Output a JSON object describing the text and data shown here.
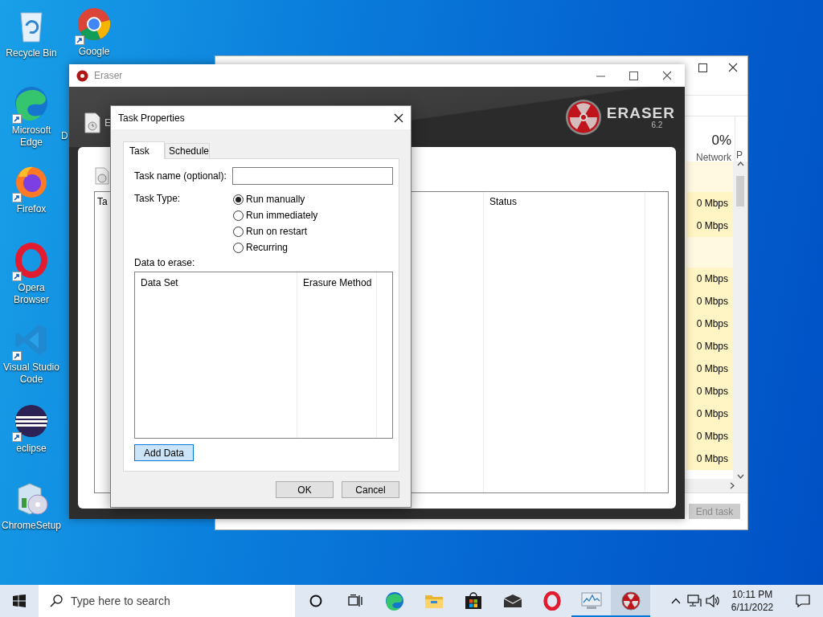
{
  "desktop": {
    "icons": [
      {
        "label": "Recycle Bin",
        "kind": "bin",
        "shortcut": false
      },
      {
        "label": "Google",
        "kind": "chrome",
        "shortcut": true
      },
      {
        "label": "Microsoft Edge",
        "kind": "edge",
        "shortcut": true
      },
      {
        "label": "D",
        "kind": "hidden",
        "shortcut": false
      },
      {
        "label": "Firefox",
        "kind": "firefox",
        "shortcut": true
      },
      {
        "label": "Opera Browser",
        "kind": "opera",
        "shortcut": true
      },
      {
        "label": "Visual Studio Code",
        "kind": "vscode",
        "shortcut": true
      },
      {
        "label": "eclipse",
        "kind": "eclipse",
        "shortcut": true
      },
      {
        "label": "ChromeSetup",
        "kind": "setup",
        "shortcut": false
      }
    ]
  },
  "task_manager": {
    "usage": "0%",
    "column_header": "Network",
    "column_2_header": "P",
    "rows": [
      {
        "kind": "group"
      },
      {
        "kind": "value",
        "network": "0 Mbps"
      },
      {
        "kind": "value",
        "network": "0 Mbps"
      },
      {
        "kind": "group"
      },
      {
        "kind": "value",
        "network": "0 Mbps"
      },
      {
        "kind": "value",
        "network": "0 Mbps"
      },
      {
        "kind": "value",
        "network": "0 Mbps"
      },
      {
        "kind": "value",
        "network": "0 Mbps"
      },
      {
        "kind": "value",
        "network": "0 Mbps"
      },
      {
        "kind": "value",
        "network": "0 Mbps"
      },
      {
        "kind": "value",
        "network": "0 Mbps"
      },
      {
        "kind": "value",
        "network": "0 Mbps"
      },
      {
        "kind": "value",
        "network": "0 Mbps"
      }
    ],
    "end_task": {
      "label": "End task",
      "disabled": true
    }
  },
  "eraser": {
    "title": "Eraser",
    "toolbar_label": "E",
    "logo": {
      "name": "ERASER",
      "version": "6.2"
    },
    "columns": [
      "Ta",
      "Status"
    ]
  },
  "dialog": {
    "title": "Task Properties",
    "tabs": [
      {
        "label": "Task",
        "selected": true
      },
      {
        "label": "Schedule",
        "selected": false
      }
    ],
    "task_name": {
      "label": "Task name (optional):"
    },
    "task_type": {
      "label": "Task Type:",
      "options": [
        {
          "label": "Run manually",
          "selected": true
        },
        {
          "label": "Run immediately",
          "selected": false
        },
        {
          "label": "Run on restart",
          "selected": false
        },
        {
          "label": "Recurring",
          "selected": false
        }
      ]
    },
    "data": {
      "label": "Data to erase:",
      "columns": [
        "Data Set",
        "Erasure Method"
      ]
    },
    "add_button": "Add Data",
    "buttons": [
      "OK",
      "Cancel"
    ]
  },
  "taskbar": {
    "search_placeholder": "Type here to search",
    "apps": [
      {
        "kind": "cortana",
        "running": false,
        "active": false
      },
      {
        "kind": "taskview",
        "running": false,
        "active": false
      },
      {
        "kind": "edge",
        "running": false,
        "active": false
      },
      {
        "kind": "explorer",
        "running": false,
        "active": false
      },
      {
        "kind": "store",
        "running": false,
        "active": false
      },
      {
        "kind": "mail",
        "running": false,
        "active": false
      },
      {
        "kind": "opera",
        "running": false,
        "active": false
      },
      {
        "kind": "taskmanager",
        "running": true,
        "active": false
      },
      {
        "kind": "eraser",
        "running": true,
        "active": true
      }
    ],
    "time": "10:11 PM",
    "date": "6/11/2022"
  }
}
